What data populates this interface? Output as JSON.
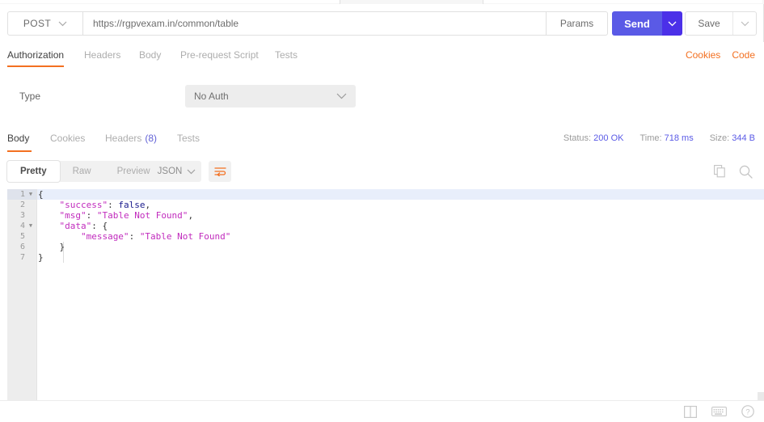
{
  "request": {
    "method": "POST",
    "url": "https://rgpvexam.in/common/table",
    "params_label": "Params",
    "send_label": "Send",
    "save_label": "Save",
    "tabs": [
      {
        "label": "Authorization",
        "active": true
      },
      {
        "label": "Headers",
        "active": false
      },
      {
        "label": "Body",
        "active": false
      },
      {
        "label": "Pre-request Script",
        "active": false
      },
      {
        "label": "Tests",
        "active": false
      }
    ],
    "links": [
      {
        "label": "Cookies"
      },
      {
        "label": "Code"
      }
    ]
  },
  "auth": {
    "type_label": "Type",
    "type_value": "No Auth"
  },
  "response": {
    "tabs": [
      {
        "label": "Body",
        "count": "",
        "active": true
      },
      {
        "label": "Cookies",
        "count": "",
        "active": false
      },
      {
        "label": "Headers",
        "count": "(8)",
        "active": false
      },
      {
        "label": "Tests",
        "count": "",
        "active": false
      }
    ],
    "status_label": "Status:",
    "status_value": "200 OK",
    "time_label": "Time:",
    "time_value": "718 ms",
    "size_label": "Size:",
    "size_value": "344 B",
    "view_modes": [
      {
        "label": "Pretty",
        "active": true
      },
      {
        "label": "Raw",
        "active": false
      },
      {
        "label": "Preview",
        "active": false
      }
    ],
    "format": "JSON"
  },
  "body": {
    "lines": [
      {
        "num": "1",
        "fold": "▼",
        "indent": 0,
        "tokens": [
          {
            "t": "{",
            "c": "p"
          }
        ]
      },
      {
        "num": "2",
        "fold": "",
        "indent": 4,
        "tokens": [
          {
            "t": "\"success\"",
            "c": "k"
          },
          {
            "t": ": ",
            "c": "p"
          },
          {
            "t": "false",
            "c": "b"
          },
          {
            "t": ",",
            "c": "p"
          }
        ]
      },
      {
        "num": "3",
        "fold": "",
        "indent": 4,
        "tokens": [
          {
            "t": "\"msg\"",
            "c": "k"
          },
          {
            "t": ": ",
            "c": "p"
          },
          {
            "t": "\"Table Not Found\"",
            "c": "s"
          },
          {
            "t": ",",
            "c": "p"
          }
        ]
      },
      {
        "num": "4",
        "fold": "▼",
        "indent": 4,
        "tokens": [
          {
            "t": "\"data\"",
            "c": "k"
          },
          {
            "t": ": ",
            "c": "p"
          },
          {
            "t": "{",
            "c": "p"
          }
        ]
      },
      {
        "num": "5",
        "fold": "",
        "indent": 8,
        "tokens": [
          {
            "t": "\"message\"",
            "c": "k"
          },
          {
            "t": ": ",
            "c": "p"
          },
          {
            "t": "\"Table Not Found\"",
            "c": "s"
          }
        ]
      },
      {
        "num": "6",
        "fold": "",
        "indent": 4,
        "tokens": [
          {
            "t": "}",
            "c": "p"
          }
        ]
      },
      {
        "num": "7",
        "fold": "",
        "indent": 0,
        "tokens": [
          {
            "t": "}",
            "c": "p"
          }
        ]
      }
    ]
  },
  "icons": {
    "method_caret": "chevron-down-icon",
    "send_caret": "chevron-down-icon",
    "save_caret": "chevron-down-icon",
    "type_caret": "chevron-down-icon",
    "format_caret": "chevron-down-icon",
    "wrap": "word-wrap-icon",
    "copy": "copy-icon",
    "search": "search-icon",
    "layout": "split-pane-icon",
    "keyboard": "keyboard-icon",
    "help": "help-icon"
  },
  "colors": {
    "accent": "#f37021",
    "send": "#5a5ae6",
    "send_caret": "#4b30e8",
    "link": "#6262d6",
    "json_key": "#c12bbd",
    "json_bool": "#1a1a8c"
  }
}
